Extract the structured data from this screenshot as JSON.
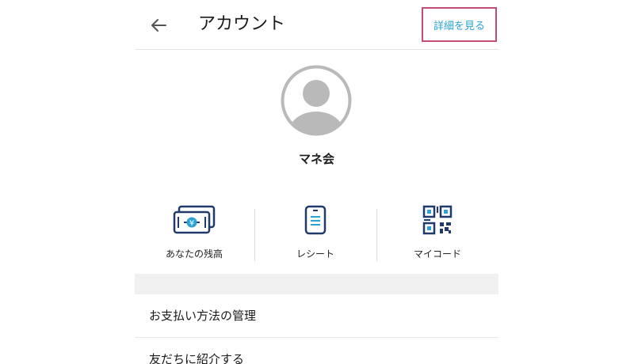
{
  "header": {
    "back_icon": "arrow-left-icon",
    "title": "アカウント",
    "detail_label": "詳細を見る"
  },
  "profile": {
    "avatar_icon": "user-avatar-icon",
    "name": "マネ会"
  },
  "shortcuts": [
    {
      "label": "あなたの残高",
      "icon": "yen-banknote-icon"
    },
    {
      "label": "レシート",
      "icon": "receipt-icon"
    },
    {
      "label": "マイコード",
      "icon": "qr-code-icon"
    }
  ],
  "menu": {
    "items": [
      {
        "label": "お支払い方法の管理"
      },
      {
        "label": "友だちに紹介する"
      }
    ]
  },
  "colors": {
    "accent_blue": "#2aa3d4",
    "icon_navy": "#1f3a6b",
    "highlight_border": "#c54b78",
    "avatar_gray": "#b9b9b9"
  }
}
